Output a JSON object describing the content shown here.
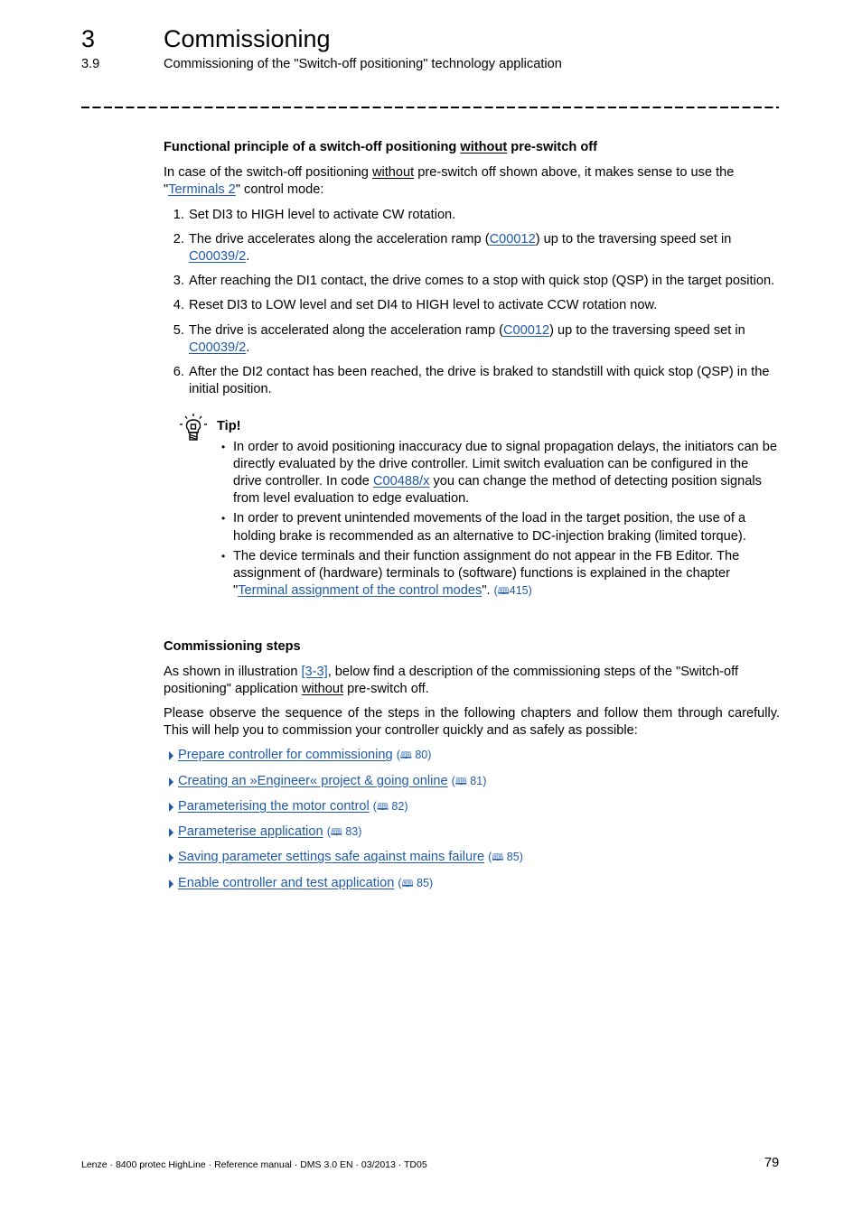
{
  "header": {
    "chapter_number": "3",
    "chapter_title": "Commissioning",
    "section_number": "3.9",
    "section_title": "Commissioning of the \"Switch-off positioning\" technology application"
  },
  "functional_principle": {
    "heading_pre": "Functional principle of a switch-off positioning ",
    "heading_underlined": "without",
    "heading_post": " pre-switch off",
    "intro_pre": "In case of the switch-off positioning ",
    "intro_underlined": "without",
    "intro_mid": " pre-switch off shown above, it makes sense to use the \"",
    "intro_link": "Terminals 2",
    "intro_post": "\" control mode:",
    "steps": [
      {
        "text": "Set DI3 to HIGH level to activate CW rotation."
      },
      {
        "pre": "The drive accelerates along the acceleration ramp (",
        "link1": "C00012",
        "mid": ") up to the traversing speed set in ",
        "link2": "C00039/2",
        "post": "."
      },
      {
        "text": "After reaching the DI1 contact, the drive comes to a stop with quick stop (QSP) in the target position."
      },
      {
        "text": "Reset DI3 to LOW level and set DI4 to HIGH level to activate CCW rotation now."
      },
      {
        "pre": "The drive is accelerated along the acceleration ramp (",
        "link1": "C00012",
        "mid": ") up to the traversing speed set in ",
        "link2": "C00039/2",
        "post": "."
      },
      {
        "text": "After the DI2 contact has been reached, the drive is braked to standstill with quick stop (QSP) in the initial position."
      }
    ]
  },
  "tip": {
    "icon": "lightbulb-icon",
    "label": "Tip!",
    "items": [
      {
        "pre": "In order to avoid positioning inaccuracy due to signal propagation delays, the initiators can be directly evaluated by the drive controller. Limit switch evaluation can be configured in the drive controller. In code ",
        "link": "C00488/x",
        "post": " you can change the method of detecting position signals from level evaluation to edge evaluation."
      },
      {
        "text": "In order to prevent unintended movements of the load in the target position, the use of a holding brake is recommended as an alternative to DC-injection braking (limited torque)."
      },
      {
        "pre": "The device terminals and their function assignment do not appear in the FB Editor. The assignment of (hardware) terminals to (software) functions is explained in the chapter \"",
        "link": "Terminal assignment of the control modes",
        "post": "\". ",
        "page_ref": "415"
      }
    ]
  },
  "commissioning_steps": {
    "heading": "Commissioning steps",
    "para1_pre": "As shown in illustration ",
    "para1_link": "[3-3]",
    "para1_mid": ", below find a description of the commissioning steps of the \"Switch-off positioning\" application ",
    "para1_underlined": "without",
    "para1_post": " pre-switch off.",
    "para2": "Please observe the sequence of the steps in the following chapters and follow them through carefully. This will help you to commission your controller quickly and as safely as possible:",
    "links": [
      {
        "label": "Prepare controller for commissioning",
        "page": "80"
      },
      {
        "label": "Creating an »Engineer« project & going online",
        "page": "81"
      },
      {
        "label": "Parameterising the motor control",
        "page": "82"
      },
      {
        "label": "Parameterise application",
        "page": "83"
      },
      {
        "label": "Saving parameter settings safe against mains failure",
        "page": "85"
      },
      {
        "label": "Enable controller and test application",
        "page": "85"
      }
    ]
  },
  "footer": {
    "text": "Lenze · 8400 protec HighLine · Reference manual · DMS 3.0 EN · 03/2013 · TD05",
    "page_number": "79"
  },
  "colors": {
    "link": "#1f5aa6",
    "text": "#000000"
  }
}
